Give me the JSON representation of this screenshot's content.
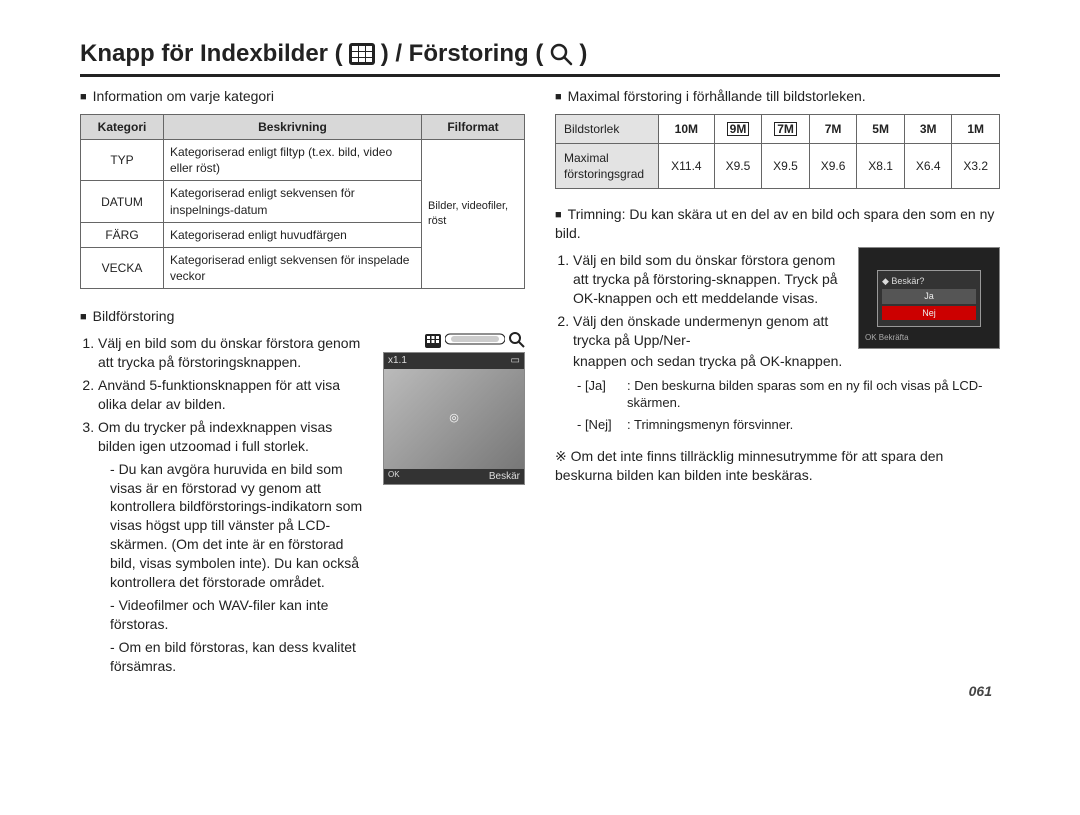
{
  "title_parts": {
    "prefix": "Knapp för Indexbilder (",
    "mid": ") / Förstoring (",
    "suffix": ")"
  },
  "left": {
    "info_heading": "Information om varje kategori",
    "table_headers": [
      "Kategori",
      "Beskrivning",
      "Filformat"
    ],
    "rows": [
      {
        "k": "TYP",
        "d": "Kategoriserad enligt filtyp (t.ex. bild, video eller röst)"
      },
      {
        "k": "DATUM",
        "d": "Kategoriserad enligt sekvensen för inspelnings-datum"
      },
      {
        "k": "FÄRG",
        "d": "Kategoriserad enligt huvudfärgen"
      },
      {
        "k": "VECKA",
        "d": "Kategoriserad enligt sekvensen för inspelade veckor"
      }
    ],
    "fileformat_cell": "Bilder, videofiler, röst",
    "zoom_heading": "Bildförstoring",
    "steps": [
      "Välj en bild som du önskar förstora genom att trycka på förstoringsknappen.",
      "Använd 5-funktionsknappen för att visa olika delar av bilden.",
      "Om du trycker på indexknappen visas bilden igen utzoomad i full storlek."
    ],
    "subnotes": [
      "Du kan avgöra huruvida en bild som visas är en förstorad vy genom att kontrollera bildförstorings-indikatorn som visas högst upp till vänster på LCD-skärmen. (Om det inte är en förstorad bild, visas symbolen inte). Du kan också kontrollera det förstorade området.",
      "Videofilmer och WAV-filer kan inte förstoras.",
      "Om en bild förstoras, kan dess kvalitet försämras."
    ],
    "thumb_label": "Beskär",
    "thumb_zoom": "x1.1"
  },
  "right": {
    "max_heading": "Maximal förstoring i förhållande till bildstorleken.",
    "size_row_label": "Bildstorlek",
    "ratio_row_label": "Maximal förstoringsgrad",
    "sizes": [
      "10M",
      "9M",
      "7M",
      "7M",
      "5M",
      "3M",
      "1M"
    ],
    "size_boxed": [
      false,
      true,
      true,
      false,
      false,
      false,
      false
    ],
    "ratios": [
      "X11.4",
      "X9.5",
      "X9.5",
      "X9.6",
      "X8.1",
      "X6.4",
      "X3.2"
    ],
    "trim_heading": "Trimning: Du kan skära ut en del av en bild och spara den som en ny bild.",
    "trim_steps_line1": "Välj en bild som du önskar förstora genom att trycka på förstoring-sknappen. Tryck på OK-knappen och ett meddelande visas.",
    "trim_steps_line2_a": "Välj den önskade undermenyn genom att trycka på Upp/Ner-",
    "trim_steps_line2_b": "knappen och sedan trycka på OK-knappen.",
    "options": [
      {
        "key": "- [Ja]",
        "desc": ": Den beskurna bilden sparas som en ny fil och visas på LCD-skärmen."
      },
      {
        "key": "- [Nej]",
        "desc": ": Trimningsmenyn försvinner."
      }
    ],
    "warning_symbol": "※",
    "warning_text": "Om det inte finns tillräcklig minnesutrymme för att spara den beskurna bilden kan bilden inte beskäras.",
    "dialog": {
      "title": "Beskär?",
      "yes": "Ja",
      "no": "Nej",
      "confirm": "Bekräfta"
    }
  },
  "page_number": "061"
}
